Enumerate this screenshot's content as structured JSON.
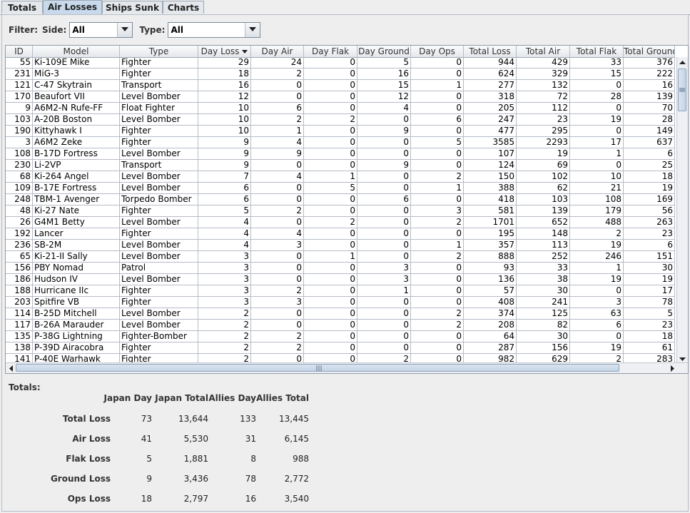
{
  "tabs": [
    "Totals",
    "Air Losses",
    "Ships Sunk",
    "Charts"
  ],
  "active_tab": "Air Losses",
  "filter": {
    "label": "Filter:",
    "side_label": "Side:",
    "side_value": "All",
    "type_label": "Type:",
    "type_value": "All"
  },
  "table": {
    "columns": [
      "ID",
      "Model",
      "Type",
      "Day Loss",
      "Day Air",
      "Day Flak",
      "Day Ground",
      "Day Ops",
      "Total Loss",
      "Total Air",
      "Total Flak",
      "Total Ground"
    ],
    "sorted_column": "Day Loss",
    "rows": [
      [
        "55",
        "Ki-109E Mike",
        "Fighter",
        "29",
        "24",
        "0",
        "5",
        "0",
        "944",
        "429",
        "33",
        "376"
      ],
      [
        "231",
        "MiG-3",
        "Fighter",
        "18",
        "2",
        "0",
        "16",
        "0",
        "624",
        "329",
        "15",
        "222"
      ],
      [
        "121",
        "C-47 Skytrain",
        "Transport",
        "16",
        "0",
        "0",
        "15",
        "1",
        "277",
        "132",
        "0",
        "16"
      ],
      [
        "170",
        "Beaufort VII",
        "Level Bomber",
        "12",
        "0",
        "0",
        "12",
        "0",
        "318",
        "72",
        "28",
        "139"
      ],
      [
        "9",
        "A6M2-N Rufe-FF",
        "Float Fighter",
        "10",
        "6",
        "0",
        "4",
        "0",
        "205",
        "112",
        "0",
        "70"
      ],
      [
        "103",
        "A-20B Boston",
        "Level Bomber",
        "10",
        "2",
        "2",
        "0",
        "6",
        "247",
        "23",
        "19",
        "28"
      ],
      [
        "190",
        "Kittyhawk I",
        "Fighter",
        "10",
        "1",
        "0",
        "9",
        "0",
        "477",
        "295",
        "0",
        "149"
      ],
      [
        "3",
        "A6M2 Zeke",
        "Fighter",
        "9",
        "4",
        "0",
        "0",
        "5",
        "3585",
        "2293",
        "17",
        "637"
      ],
      [
        "108",
        "B-17D Fortress",
        "Level Bomber",
        "9",
        "9",
        "0",
        "0",
        "0",
        "107",
        "19",
        "1",
        "6"
      ],
      [
        "230",
        "Li-2VP",
        "Transport",
        "9",
        "0",
        "0",
        "9",
        "0",
        "124",
        "69",
        "0",
        "25"
      ],
      [
        "68",
        "Ki-264 Angel",
        "Level Bomber",
        "7",
        "4",
        "1",
        "0",
        "2",
        "150",
        "102",
        "10",
        "18"
      ],
      [
        "109",
        "B-17E Fortress",
        "Level Bomber",
        "6",
        "0",
        "5",
        "0",
        "1",
        "388",
        "62",
        "21",
        "19"
      ],
      [
        "248",
        "TBM-1 Avenger",
        "Torpedo Bomber",
        "6",
        "0",
        "0",
        "6",
        "0",
        "418",
        "103",
        "108",
        "169"
      ],
      [
        "48",
        "Ki-27 Nate",
        "Fighter",
        "5",
        "2",
        "0",
        "0",
        "3",
        "581",
        "139",
        "179",
        "56"
      ],
      [
        "26",
        "G4M1 Betty",
        "Level Bomber",
        "4",
        "0",
        "2",
        "0",
        "2",
        "1701",
        "652",
        "488",
        "263"
      ],
      [
        "192",
        "Lancer",
        "Fighter",
        "4",
        "4",
        "0",
        "0",
        "0",
        "195",
        "148",
        "2",
        "23"
      ],
      [
        "236",
        "SB-2M",
        "Level Bomber",
        "4",
        "3",
        "0",
        "0",
        "1",
        "357",
        "113",
        "19",
        "6"
      ],
      [
        "65",
        "Ki-21-II Sally",
        "Level Bomber",
        "3",
        "0",
        "1",
        "0",
        "2",
        "888",
        "252",
        "246",
        "151"
      ],
      [
        "156",
        "PBY Nomad",
        "Patrol",
        "3",
        "0",
        "0",
        "3",
        "0",
        "93",
        "33",
        "1",
        "30"
      ],
      [
        "186",
        "Hudson IV",
        "Level Bomber",
        "3",
        "0",
        "0",
        "3",
        "0",
        "136",
        "38",
        "19",
        "19"
      ],
      [
        "188",
        "Hurricane IIc",
        "Fighter",
        "3",
        "2",
        "0",
        "1",
        "0",
        "57",
        "30",
        "0",
        "17"
      ],
      [
        "203",
        "Spitfire VB",
        "Fighter",
        "3",
        "3",
        "0",
        "0",
        "0",
        "408",
        "241",
        "3",
        "78"
      ],
      [
        "114",
        "B-25D Mitchell",
        "Level Bomber",
        "2",
        "0",
        "0",
        "0",
        "2",
        "374",
        "125",
        "63",
        "5"
      ],
      [
        "117",
        "B-26A Marauder",
        "Level Bomber",
        "2",
        "0",
        "0",
        "0",
        "2",
        "208",
        "82",
        "6",
        "23"
      ],
      [
        "135",
        "P-38G Lightning",
        "Fighter-Bomber",
        "2",
        "2",
        "0",
        "0",
        "0",
        "64",
        "30",
        "0",
        "18"
      ],
      [
        "138",
        "P-39D Airacobra",
        "Fighter",
        "2",
        "2",
        "0",
        "0",
        "0",
        "287",
        "156",
        "19",
        "61"
      ],
      [
        "141",
        "P-40E Warhawk",
        "Fighter",
        "2",
        "0",
        "0",
        "2",
        "0",
        "982",
        "629",
        "2",
        "283"
      ]
    ]
  },
  "totals": {
    "title": "Totals:",
    "headers": [
      "Japan Day",
      "Japan Total",
      "Allies Day",
      "Allies Total"
    ],
    "rows": [
      {
        "label": "Total Loss",
        "values": [
          "73",
          "13,644",
          "133",
          "13,445"
        ]
      },
      {
        "label": "Air Loss",
        "values": [
          "41",
          "5,530",
          "31",
          "6,145"
        ]
      },
      {
        "label": "Flak Loss",
        "values": [
          "5",
          "1,881",
          "8",
          "988"
        ]
      },
      {
        "label": "Ground Loss",
        "values": [
          "9",
          "3,436",
          "78",
          "2,772"
        ]
      },
      {
        "label": "Ops Loss",
        "values": [
          "18",
          "2,797",
          "16",
          "3,540"
        ]
      }
    ]
  },
  "colors": {
    "tab_active": "#c8d9ec",
    "scroll_thumb": "#c4d3e5",
    "grid_line": "#b5bcc6"
  }
}
